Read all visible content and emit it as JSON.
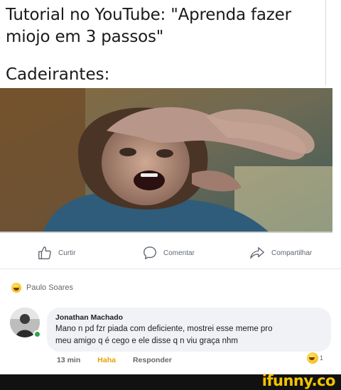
{
  "post": {
    "caption_line1": "Tutorial no YouTube: \"Aprenda fazer",
    "caption_line2": "miojo em 3 passos\"",
    "caption_line3": "Cadeirantes:"
  },
  "actions": {
    "like": "Curtir",
    "comment": "Comentar",
    "share": "Compartilhar"
  },
  "reaction": {
    "user": "Paulo Soares"
  },
  "comment": {
    "author": "Jonathan Machado",
    "text_line1": "Mano n pd fzr piada com deficiente, mostrei esse meme pro",
    "text_line2": "meu amigo q é cego e ele disse q n viu graça nhm",
    "time": "13 min",
    "haha": "Haha",
    "reply": "Responder",
    "reaction_count": "1"
  },
  "watermark": "ifunny.co",
  "colors": {
    "haha": "#e4a200",
    "online": "#31a24c",
    "bubble": "#f0f2f5",
    "ifunny": "#f5c400"
  }
}
